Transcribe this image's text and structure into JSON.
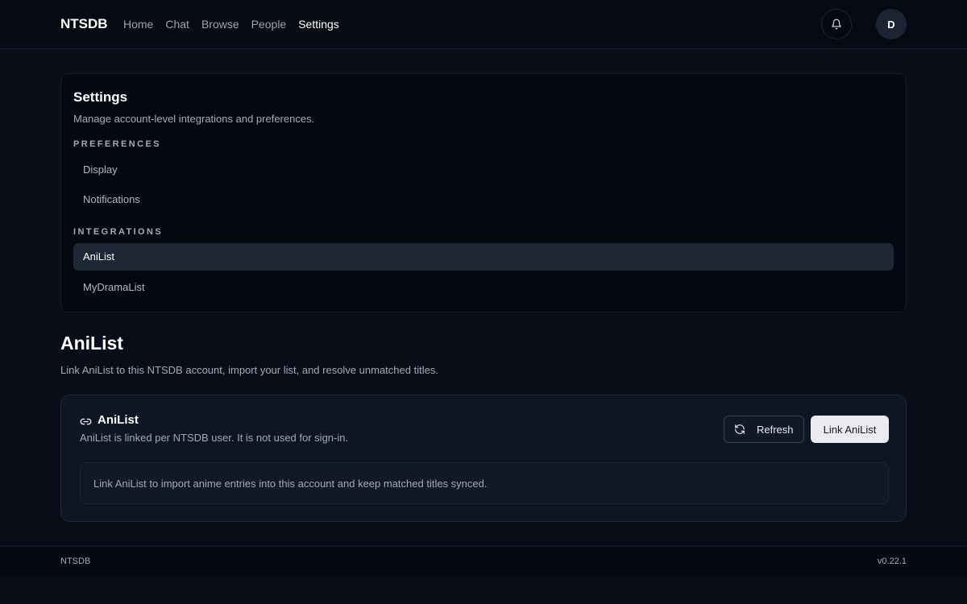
{
  "header": {
    "brand": "NTSDB",
    "nav": [
      "Home",
      "Chat",
      "Browse",
      "People",
      "Settings"
    ],
    "active_nav": "Settings",
    "notification_icon": "bell-icon",
    "avatar_initial": "D"
  },
  "settings": {
    "title": "Settings",
    "subtitle": "Manage account-level integrations and preferences.",
    "preferences_label": "PREFERENCES",
    "preferences_items": [
      "Display",
      "Notifications"
    ],
    "integrations_label": "INTEGRATIONS",
    "integrations_items": [
      "AniList",
      "MyDramaList"
    ],
    "selected_item": "AniList"
  },
  "section": {
    "title": "AniList",
    "description": "Link AniList to this NTSDB account, import your list, and resolve unmatched titles."
  },
  "integration_card": {
    "icon": "link-icon",
    "title": "AniList",
    "subtitle": "AniList is linked per NTSDB user. It is not used for sign-in.",
    "refresh_label": "Refresh",
    "refresh_icon": "refresh-icon",
    "link_label": "Link AniList",
    "info": "Link AniList to import anime entries into this account and keep matched titles synced."
  },
  "footer": {
    "brand": "NTSDB",
    "version": "v0.22.1"
  },
  "colors": {
    "background": "#080d18",
    "card": "#040810",
    "selected": "#1d2736",
    "primary_button": "#e9ebef"
  }
}
